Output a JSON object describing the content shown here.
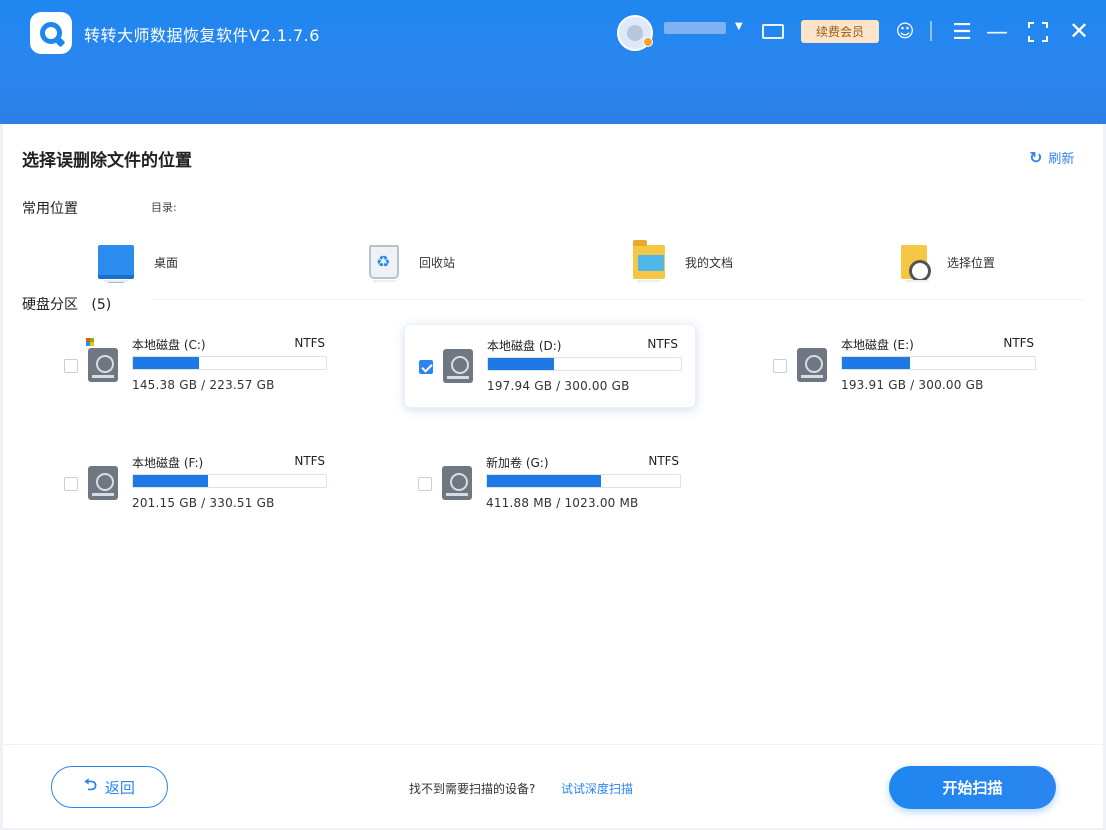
{
  "app": {
    "title": "转转大师数据恢复软件V2.1.7.6"
  },
  "header": {
    "renew_label": "续费会员"
  },
  "page": {
    "title": "选择误删除文件的位置",
    "refresh_label": "刷新"
  },
  "common": {
    "label": "常用位置",
    "dir_label": "目录:",
    "items": [
      {
        "label": "桌面",
        "icon": "desktop-icon"
      },
      {
        "label": "回收站",
        "icon": "recycle-bin-icon"
      },
      {
        "label": "我的文档",
        "icon": "documents-folder-icon"
      },
      {
        "label": "选择位置",
        "icon": "choose-location-icon"
      }
    ]
  },
  "disks": {
    "label": "硬盘分区",
    "count": "(5)",
    "items": [
      {
        "name": "本地磁盘  (C:)",
        "fs": "NTFS",
        "size": "145.38 GB / 223.57 GB",
        "used_fraction": 0.34,
        "checked": false,
        "system": true
      },
      {
        "name": "本地磁盘  (D:)",
        "fs": "NTFS",
        "size": "197.94 GB / 300.00 GB",
        "used_fraction": 0.34,
        "checked": true,
        "system": false
      },
      {
        "name": "本地磁盘  (E:)",
        "fs": "NTFS",
        "size": "193.91 GB / 300.00 GB",
        "used_fraction": 0.35,
        "checked": false,
        "system": false
      },
      {
        "name": "本地磁盘  (F:)",
        "fs": "NTFS",
        "size": "201.15 GB / 330.51 GB",
        "used_fraction": 0.39,
        "checked": false,
        "system": false
      },
      {
        "name": "新加卷  (G:)",
        "fs": "NTFS",
        "size": "411.88 MB / 1023.00 MB",
        "used_fraction": 0.59,
        "checked": false,
        "system": false
      }
    ]
  },
  "footer": {
    "back_label": "返回",
    "hint": "找不到需要扫描的设备?",
    "deep_scan_label": "试试深度扫描",
    "start_label": "开始扫描"
  },
  "colors": {
    "primary": "#2a86ee",
    "bar_fill": "#1e78e6",
    "renew_bg": "#fbe4c8"
  }
}
